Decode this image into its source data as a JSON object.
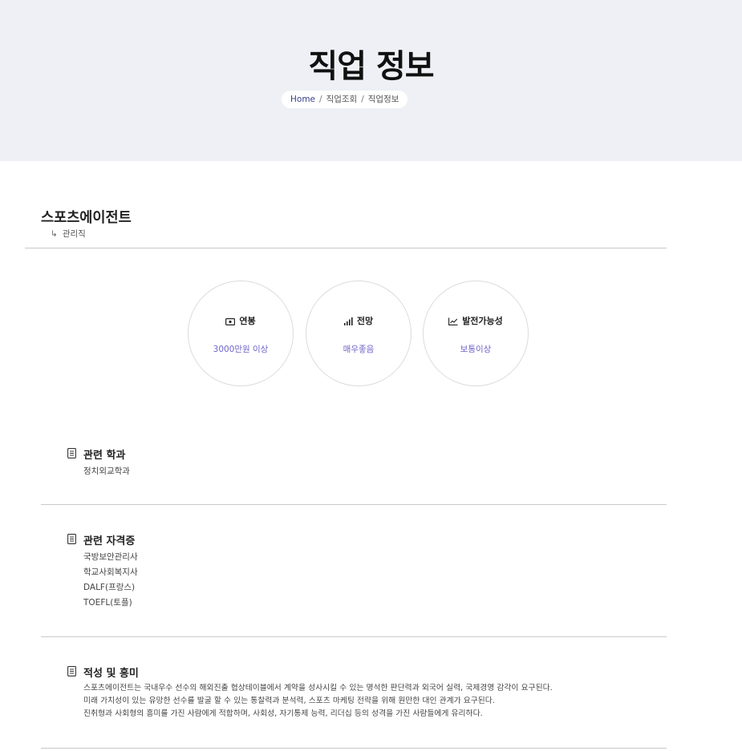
{
  "hero": {
    "title": "직업 정보",
    "breadcrumb": {
      "home": "Home",
      "level1": "직업조회",
      "level2": "직업정보",
      "separator": "/"
    }
  },
  "job": {
    "title": "스포츠에이전트",
    "category_arrow": "↳",
    "category": "관리직"
  },
  "stats": [
    {
      "icon": "money-icon",
      "label": "연봉",
      "value": "3000만원 이상"
    },
    {
      "icon": "signal-bars-icon",
      "label": "전망",
      "value": "매우좋음"
    },
    {
      "icon": "trend-up-icon",
      "label": "발전가능성",
      "value": "보통이상"
    }
  ],
  "sections": {
    "departments": {
      "icon": "list-icon",
      "title": "관련 학과",
      "items": [
        "정치외교학과"
      ]
    },
    "certifications": {
      "icon": "list-icon",
      "title": "관련 자격증",
      "items": [
        "국방보안관리사",
        "학교사회복지사",
        "DALF(프랑스)",
        "TOEFL(토플)"
      ]
    },
    "aptitude": {
      "icon": "list-icon",
      "title": "적성 및 흥미",
      "lines": [
        "스포츠에이전트는 국내우수 선수의 해외진출 협상테이블에서 계약을 성사시킬 수 있는 명석한 판단력과 외국어 실력, 국제경영 감각이 요구된다.",
        "미래 가치성이 있는 유망한 선수를 발굴 할 수 있는 통찰력과 분석력, 스포츠 마케팅 전략을 위해 원만한 대인 관계가 요구된다.",
        "진취형과 사회형의 흥미를 가진 사람에게 적합하며, 사회성, 자기통제 능력, 리더십 등의 성격을 가진 사람들에게 유리하다."
      ]
    }
  },
  "colors": {
    "hero_bg": "#eef0f5",
    "accent": "#6f63c9",
    "breadcrumb_home": "#3a3f8f",
    "rule": "#c9c9c9"
  }
}
